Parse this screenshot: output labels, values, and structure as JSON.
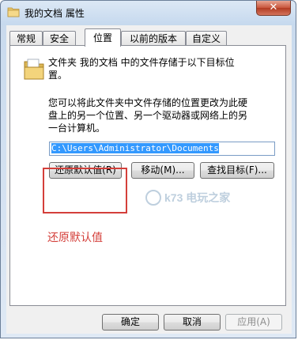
{
  "window": {
    "title": "我的文档 属性",
    "close_symbol": "✕"
  },
  "tabs": [
    "常规",
    "安全",
    "位置",
    "以前的版本",
    "自定义"
  ],
  "active_tab": "位置",
  "location": {
    "intro": "文件夹 我的文档 中的文件存储于以下目标位置。",
    "description": "您可以将此文件夹中文件存储的位置更改为此硬盘上的另一个位置、另一个驱动器或网络上的另一台计算机。",
    "path": "C:\\Users\\Administrator\\Documents",
    "restore_label": "还原默认值(R)",
    "move_label": "移动(M)...",
    "find_label": "查找目标(F)..."
  },
  "annotation": "还原默认值",
  "watermark_text": "k73 电玩之家",
  "footer": {
    "ok_label": "确定",
    "cancel_label": "取消",
    "apply_label": "应用(A)"
  },
  "colors": {
    "annotation": "#d43f3a",
    "selection": "#3399ff",
    "close_button": "#c8553b"
  }
}
